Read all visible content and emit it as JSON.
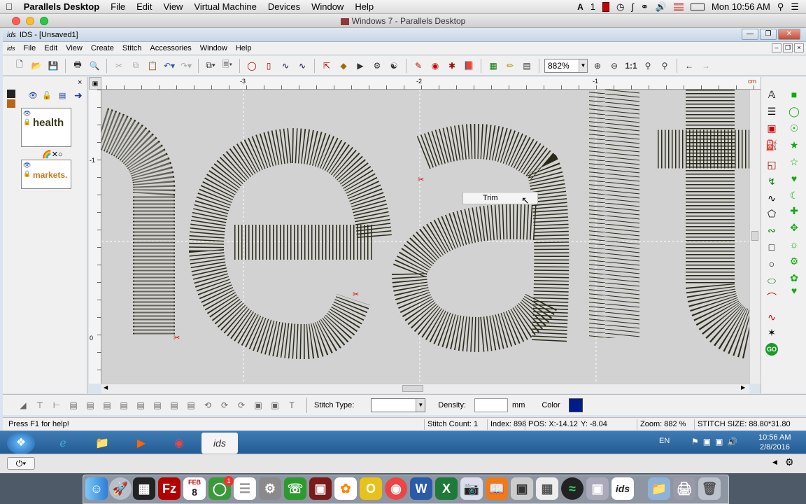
{
  "mac_menubar": {
    "apple": "",
    "app_name": "Parallels Desktop",
    "menus": [
      "File",
      "Edit",
      "View",
      "Virtual Machine",
      "Devices",
      "Window",
      "Help"
    ],
    "status_text": "1",
    "clock": "Mon 10:56 AM"
  },
  "parallels_title": "Windows 7 - Parallels Desktop",
  "ids_window": {
    "title": "IDS - [Unsaved1]",
    "menus": [
      "File",
      "Edit",
      "View",
      "Create",
      "Stitch",
      "Accessories",
      "Window",
      "Help"
    ],
    "zoom": "882%"
  },
  "rulers": {
    "h_labels": [
      "-3",
      "-2",
      "-1",
      "cm"
    ],
    "v_labels": [
      "-1",
      "0"
    ]
  },
  "layers": [
    {
      "label": "health",
      "color": "#3a3a20"
    },
    {
      "label": "markets.",
      "color": "#c77a1e"
    }
  ],
  "context_menu": {
    "item": "Trim"
  },
  "bottom_toolbar": {
    "stitch_type_label": "Stitch Type:",
    "stitch_type_value": "",
    "density_label": "Density:",
    "density_value": "",
    "density_unit": "mm",
    "color_label": "Color",
    "color_value": "#001b8c"
  },
  "status_bar": {
    "help": "Press F1 for help!",
    "stitch_count": "Stitch Count: 1",
    "index": "Index: 898",
    "pos_x": "POS: X:-14.12",
    "pos_y": "Y: -8.04",
    "zoom": "Zoom: 882 %",
    "stitch_size": "STITCH SIZE: 88.80*31.80"
  },
  "taskbar": {
    "lang": "EN",
    "time": "10:56 AM",
    "date": "2/8/2016",
    "active_app": "ids"
  },
  "dock": {
    "calendar_month": "FEB",
    "calendar_day": "8",
    "badge": "1",
    "ids_label": "ids"
  }
}
